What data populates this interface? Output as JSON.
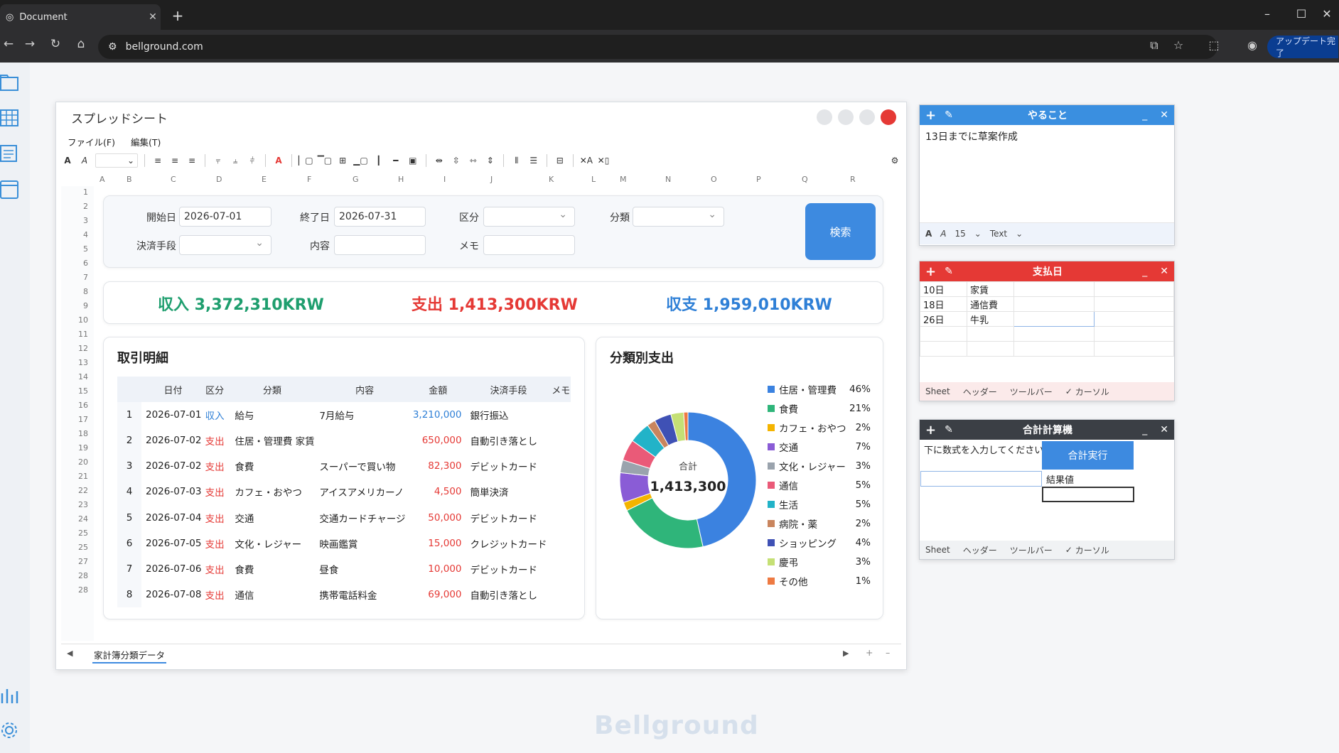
{
  "browser": {
    "tab_title": "Document",
    "url": "bellground.com",
    "update_button": "アップデート完了"
  },
  "window": {
    "title": "スプレッドシート",
    "menu": [
      "ファイル(F)",
      "編集(T)"
    ]
  },
  "columns": [
    "A",
    "B",
    "C",
    "D",
    "E",
    "F",
    "G",
    "H",
    "I",
    "J",
    "K",
    "L",
    "M",
    "N",
    "O",
    "P",
    "Q",
    "R"
  ],
  "rows": [
    "1",
    "2",
    "3",
    "4",
    "5",
    "6",
    "7",
    "8",
    "9",
    "10",
    "11",
    "12",
    "13",
    "14",
    "15",
    "16",
    "17",
    "18",
    "19",
    "20",
    "21",
    "22",
    "23",
    "24",
    "25",
    "25",
    "27",
    "28",
    "28"
  ],
  "filter": {
    "start_label": "開始日",
    "start_value": "2026-07-01",
    "end_label": "終了日",
    "end_value": "2026-07-31",
    "category_label": "区分",
    "category_value": "",
    "class_label": "分類",
    "class_value": "",
    "payment_label": "決済手段",
    "payment_value": "",
    "content_label": "内容",
    "content_value": "",
    "memo_label": "メモ",
    "memo_value": "",
    "search_button": "検索"
  },
  "summary": {
    "income": "収入 3,372,310KRW",
    "expense": "支出 1,413,300KRW",
    "balance": "収支 1,959,010KRW",
    "income_color": "#1e9e6e",
    "expense_color": "#e53935",
    "balance_color": "#2e7fd6"
  },
  "transactions": {
    "title": "取引明細",
    "headers": [
      "",
      "日付",
      "区分",
      "分類",
      "内容",
      "金額",
      "決済手段",
      "メモ"
    ],
    "rows": [
      {
        "n": "1",
        "date": "2026-07-01",
        "kind": "収入",
        "cls": "給与",
        "content": "7月給与",
        "amount": "3,210,000",
        "pay": "銀行振込",
        "memo": ""
      },
      {
        "n": "2",
        "date": "2026-07-02",
        "kind": "支出",
        "cls": "住居・管理費 家賃",
        "content": "",
        "amount": "650,000",
        "pay": "自動引き落とし",
        "memo": ""
      },
      {
        "n": "3",
        "date": "2026-07-02",
        "kind": "支出",
        "cls": "食費",
        "content": "スーパーで買い物",
        "amount": "82,300",
        "pay": "デビットカード",
        "memo": ""
      },
      {
        "n": "4",
        "date": "2026-07-03",
        "kind": "支出",
        "cls": "カフェ・おやつ",
        "content": "アイスアメリカーノ",
        "amount": "4,500",
        "pay": "簡単決済",
        "memo": ""
      },
      {
        "n": "5",
        "date": "2026-07-04",
        "kind": "支出",
        "cls": "交通",
        "content": "交通カードチャージ",
        "amount": "50,000",
        "pay": "デビットカード",
        "memo": ""
      },
      {
        "n": "6",
        "date": "2026-07-05",
        "kind": "支出",
        "cls": "文化・レジャー",
        "content": "映画鑑賞",
        "amount": "15,000",
        "pay": "クレジットカード",
        "memo": ""
      },
      {
        "n": "7",
        "date": "2026-07-06",
        "kind": "支出",
        "cls": "食費",
        "content": "昼食",
        "amount": "10,000",
        "pay": "デビットカード",
        "memo": ""
      },
      {
        "n": "8",
        "date": "2026-07-08",
        "kind": "支出",
        "cls": "通信",
        "content": "携帯電話料金",
        "amount": "69,000",
        "pay": "自動引き落とし",
        "memo": ""
      }
    ]
  },
  "chart_data": {
    "type": "pie",
    "title": "分類別支出",
    "center_label": "合計",
    "center_value": "1,413,300",
    "legend_placement": "right",
    "categories": [
      "住居・管理費",
      "食費",
      "カフェ・おやつ",
      "交通",
      "文化・レジャー",
      "通信",
      "生活",
      "病院・薬",
      "ショッピング",
      "慶弔",
      "その他"
    ],
    "values": [
      46,
      21,
      2,
      7,
      3,
      5,
      5,
      2,
      4,
      3,
      1
    ],
    "labels": [
      "46%",
      "21%",
      "2%",
      "7%",
      "3%",
      "5%",
      "5%",
      "2%",
      "4%",
      "3%",
      "1%"
    ],
    "colors": [
      "#3b82e0",
      "#2fb57a",
      "#f4b400",
      "#8a5cd6",
      "#9aa3ad",
      "#ea5a78",
      "#22b3c8",
      "#c9855e",
      "#3f51b5",
      "#c5e075",
      "#ee7a42"
    ]
  },
  "sheet_tabs": {
    "active": "家計簿分類データ"
  },
  "todo_widget": {
    "title": "やること",
    "text": "13日までに草案作成",
    "font_size": "15",
    "font_type": "Text"
  },
  "payday_widget": {
    "title": "支払日",
    "rows": [
      [
        "10日",
        "家賃"
      ],
      [
        "18日",
        "通信費"
      ],
      [
        "26日",
        "牛乳"
      ]
    ],
    "footer": {
      "sheet": "Sheet",
      "header": "ヘッダー",
      "toolbar": "ツールバー",
      "cursor": "カーソル"
    }
  },
  "calc_widget": {
    "title": "合計計算機",
    "instruction": "下に数式を入力してください",
    "run_button": "合計実行",
    "result_label": "結果値",
    "footer": {
      "sheet": "Sheet",
      "header": "ヘッダー",
      "toolbar": "ツールバー",
      "cursor": "カーソル"
    }
  },
  "brand": "Bellground"
}
